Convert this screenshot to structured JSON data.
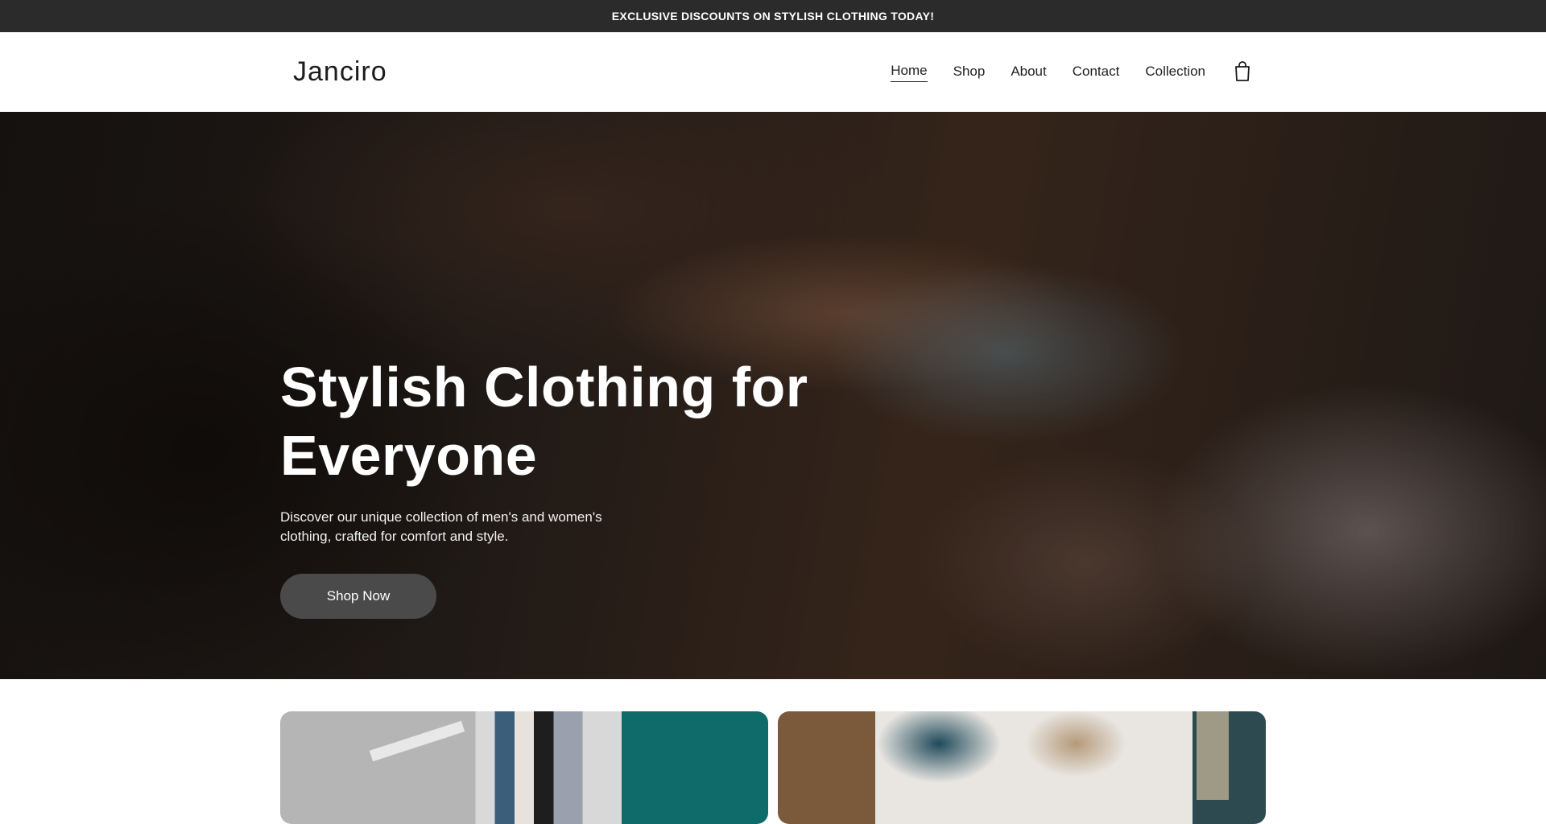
{
  "announcement": "EXCLUSIVE DISCOUNTS ON STYLISH CLOTHING TODAY!",
  "brand": "Janciro",
  "nav": {
    "items": [
      {
        "label": "Home",
        "active": true
      },
      {
        "label": "Shop"
      },
      {
        "label": "About"
      },
      {
        "label": "Contact"
      },
      {
        "label": "Collection"
      }
    ],
    "cart_icon": "shopping-bag-icon"
  },
  "hero": {
    "title_line1": "Stylish Clothing for",
    "title_line2": "Everyone",
    "subtitle": "Discover our unique collection of men's and women's clothing, crafted for comfort and style.",
    "cta": "Shop Now"
  },
  "colors": {
    "announcement_bg": "#2b2b2b",
    "button_bg": "#4a4a4a"
  }
}
